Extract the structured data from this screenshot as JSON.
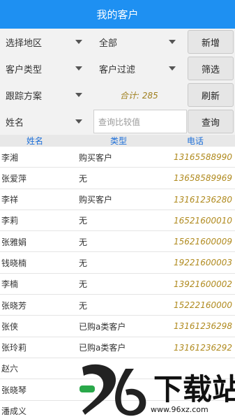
{
  "title": "我的客户",
  "filters": {
    "region": "选择地区",
    "all": "全部",
    "add_button": "新增",
    "customer_type": "客户类型",
    "customer_filter": "客户过滤",
    "filter_button": "筛选",
    "follow_plan": "跟踪方案",
    "total": "合计: 285",
    "refresh_button": "刷新",
    "field": "姓名",
    "search_placeholder": "查询比较值",
    "query_button": "查询"
  },
  "table": {
    "headers": [
      "姓名",
      "类型",
      "电话"
    ],
    "rows": [
      {
        "name": "李湘",
        "type": "购买客户",
        "phone": "13165588990"
      },
      {
        "name": "张爱萍",
        "type": "无",
        "phone": "13658589969"
      },
      {
        "name": "李祥",
        "type": "购买客户",
        "phone": "13161236280"
      },
      {
        "name": "李莉",
        "type": "无",
        "phone": "16521600010"
      },
      {
        "name": "张雅娟",
        "type": "无",
        "phone": "15621600009"
      },
      {
        "name": "钱晓楠",
        "type": "无",
        "phone": "19221600003"
      },
      {
        "name": "李楠",
        "type": "无",
        "phone": "13921600002"
      },
      {
        "name": "张晓芳",
        "type": "无",
        "phone": "15222160000"
      },
      {
        "name": "张侠",
        "type": "已购a类客户",
        "phone": "13161236298"
      },
      {
        "name": "张玲莉",
        "type": "已购a类客户",
        "phone": "13161236292"
      },
      {
        "name": "赵六",
        "type": "",
        "phone": ""
      },
      {
        "name": "张晓琴",
        "type": "",
        "phone": ""
      },
      {
        "name": "潘成义",
        "type": "",
        "phone": ""
      }
    ]
  },
  "watermark": {
    "text": "下载站",
    "url": "www.96xz.com"
  }
}
